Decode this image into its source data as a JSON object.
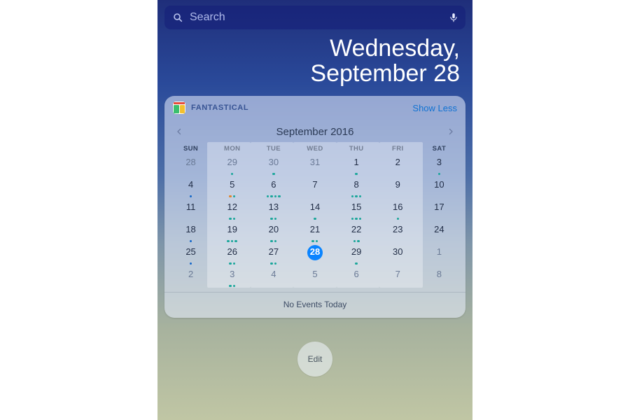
{
  "search": {
    "placeholder": "Search"
  },
  "date_header": {
    "line1": "Wednesday,",
    "line2": "September 28"
  },
  "widget": {
    "app_name": "FANTASTICAL",
    "toggle_label": "Show Less",
    "month_label": "September 2016",
    "day_headers": [
      "SUN",
      "MON",
      "TUE",
      "WED",
      "THU",
      "FRI",
      "SAT"
    ],
    "weeks": [
      [
        {
          "n": "28",
          "muted": true,
          "dots": []
        },
        {
          "n": "29",
          "muted": true,
          "dots": [
            "teal"
          ]
        },
        {
          "n": "30",
          "muted": true,
          "dots": [
            "teal"
          ]
        },
        {
          "n": "31",
          "muted": true,
          "dots": []
        },
        {
          "n": "1",
          "dots": [
            "teal"
          ]
        },
        {
          "n": "2",
          "dots": []
        },
        {
          "n": "3",
          "dots": [
            "teal"
          ]
        }
      ],
      [
        {
          "n": "4",
          "dots": [
            "blue"
          ]
        },
        {
          "n": "5",
          "dots": [
            "orange",
            "teal"
          ]
        },
        {
          "n": "6",
          "dots": [
            "teal",
            "teal",
            "teal",
            "teal"
          ]
        },
        {
          "n": "7",
          "dots": []
        },
        {
          "n": "8",
          "dots": [
            "teal",
            "teal",
            "teal"
          ]
        },
        {
          "n": "9",
          "dots": []
        },
        {
          "n": "10",
          "dots": []
        }
      ],
      [
        {
          "n": "11",
          "dots": []
        },
        {
          "n": "12",
          "dots": [
            "teal",
            "teal"
          ]
        },
        {
          "n": "13",
          "dots": [
            "teal",
            "teal"
          ]
        },
        {
          "n": "14",
          "dots": [
            "teal"
          ]
        },
        {
          "n": "15",
          "dots": [
            "teal",
            "teal",
            "teal"
          ]
        },
        {
          "n": "16",
          "dots": [
            "teal"
          ]
        },
        {
          "n": "17",
          "dots": []
        }
      ],
      [
        {
          "n": "18",
          "dots": [
            "blue"
          ]
        },
        {
          "n": "19",
          "dots": [
            "teal",
            "teal",
            "teal"
          ]
        },
        {
          "n": "20",
          "dots": [
            "teal",
            "teal"
          ]
        },
        {
          "n": "21",
          "dots": [
            "teal",
            "teal"
          ]
        },
        {
          "n": "22",
          "dots": [
            "teal",
            "teal"
          ]
        },
        {
          "n": "23",
          "dots": []
        },
        {
          "n": "24",
          "dots": []
        }
      ],
      [
        {
          "n": "25",
          "dots": [
            "blue"
          ]
        },
        {
          "n": "26",
          "dots": [
            "teal",
            "teal"
          ]
        },
        {
          "n": "27",
          "dots": [
            "teal",
            "teal"
          ]
        },
        {
          "n": "28",
          "today": true,
          "dots": []
        },
        {
          "n": "29",
          "dots": [
            "teal"
          ]
        },
        {
          "n": "30",
          "dots": []
        },
        {
          "n": "1",
          "muted": true,
          "dots": []
        }
      ],
      [
        {
          "n": "2",
          "muted": true,
          "dots": []
        },
        {
          "n": "3",
          "muted": true,
          "dots": [
            "teal",
            "teal"
          ]
        },
        {
          "n": "4",
          "muted": true,
          "dots": []
        },
        {
          "n": "5",
          "muted": true,
          "dots": []
        },
        {
          "n": "6",
          "muted": true,
          "dots": []
        },
        {
          "n": "7",
          "muted": true,
          "dots": []
        },
        {
          "n": "8",
          "muted": true,
          "dots": []
        }
      ]
    ],
    "no_events_label": "No Events Today"
  },
  "edit_label": "Edit",
  "highlight_columns": [
    1,
    2,
    3,
    4,
    5
  ]
}
